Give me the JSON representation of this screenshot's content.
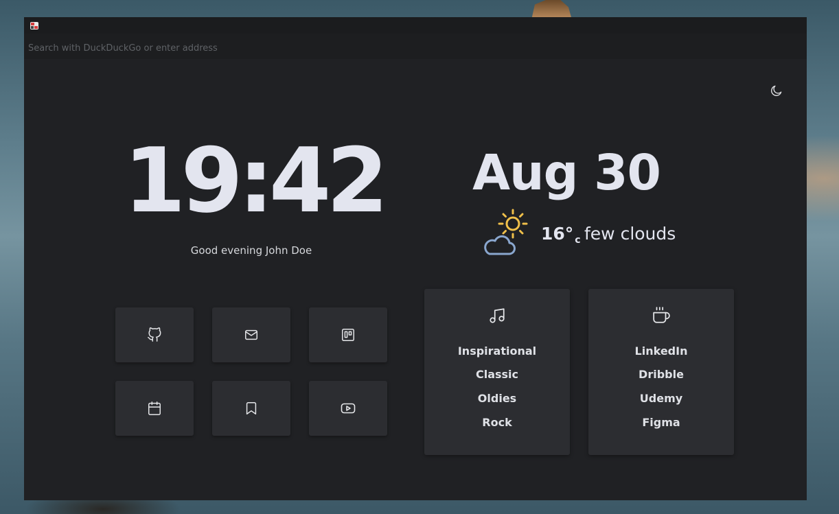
{
  "browser": {
    "address_placeholder": "Search with DuckDuckGo or enter address"
  },
  "clock": {
    "time": "19:42",
    "greeting": "Good evening John Doe"
  },
  "date": {
    "text": "Aug 30"
  },
  "weather": {
    "temperature": "16°",
    "unit": "c",
    "description": "few clouds",
    "icon": "sun-behind-cloud-icon"
  },
  "shortcuts": [
    {
      "icon": "github-icon"
    },
    {
      "icon": "mail-icon"
    },
    {
      "icon": "trello-icon"
    },
    {
      "icon": "calendar-icon"
    },
    {
      "icon": "bookmark-icon"
    },
    {
      "icon": "youtube-icon"
    }
  ],
  "link_cards": [
    {
      "icon": "music-icon",
      "links": [
        "Inspirational",
        "Classic",
        "Oldies",
        "Rock"
      ]
    },
    {
      "icon": "coffee-icon",
      "links": [
        "LinkedIn",
        "Dribble",
        "Udemy",
        "Figma"
      ]
    }
  ],
  "theme_toggle": {
    "icon": "moon-icon"
  },
  "colors": {
    "page_background": "#202124",
    "tile_background": "#2c2d31",
    "text_primary": "#e3e5ef",
    "sun_color": "#f0c04a",
    "cloud_color": "#8aa7cf"
  }
}
